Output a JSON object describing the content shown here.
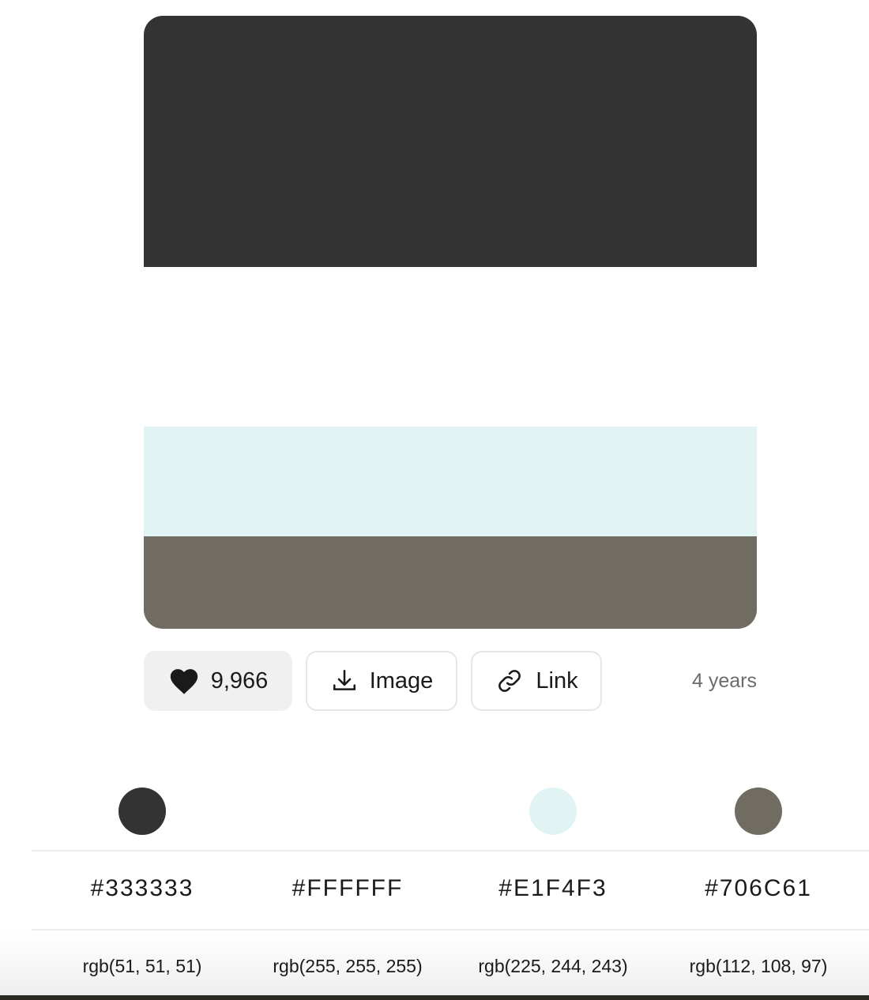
{
  "palette": {
    "colors": [
      {
        "hex": "#333333",
        "rgb": "rgb(51, 51, 51)"
      },
      {
        "hex": "#FFFFFF",
        "rgb": "rgb(255, 255, 255)"
      },
      {
        "hex": "#E1F4F3",
        "rgb": "rgb(225, 244, 243)"
      },
      {
        "hex": "#706C61",
        "rgb": "rgb(112, 108, 97)"
      }
    ]
  },
  "actions": {
    "likes": "9,966",
    "like_icon": "heart-icon",
    "image_label": "Image",
    "image_icon": "download-icon",
    "link_label": "Link",
    "link_icon": "link-icon",
    "age": "4 years"
  }
}
